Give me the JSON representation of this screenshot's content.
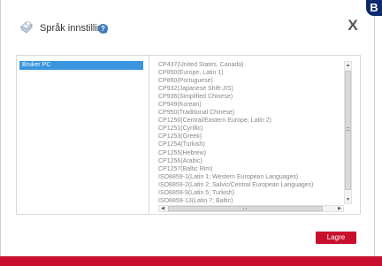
{
  "header": {
    "title": "Språk innstilling",
    "help_icon": "?",
    "close_label": "X",
    "icon": "printer-settings-icon"
  },
  "corner_badge": "B",
  "devices": [
    {
      "label": "Bruker PC",
      "selected": true
    }
  ],
  "codepages": [
    "CP437(United States, Canada)",
    "CP850(Europe, Latin 1)",
    "CP860(Portuguese)",
    "CP932(Japanese Shift-JIS)",
    "CP936(Simplified Chinese)",
    "CP949(Korean)",
    "CP950(Traditional Chinese)",
    "CP1250(Central/Eastern Europe, Latin 2)",
    "CP1251(Cyrillic)",
    "CP1253(Greek)",
    "CP1254(Turkish)",
    "CP1255(Hebrew)",
    "CP1256(Arabic)",
    "CP1257(Baltic Rim)",
    "ISO8859-1(Latin 1; Western European Languages)",
    "ISO8859-2(Latin 2; Salvic/Central European Languages)",
    "ISO8859-9(Latin 5; Turkish)",
    "ISO8859-13(Latin 7; Baltic)"
  ],
  "footer": {
    "save_label": "Lagre"
  },
  "colors": {
    "accent": "#c8102e",
    "selection": "#3a95e0",
    "badge": "#0d2a6e"
  }
}
